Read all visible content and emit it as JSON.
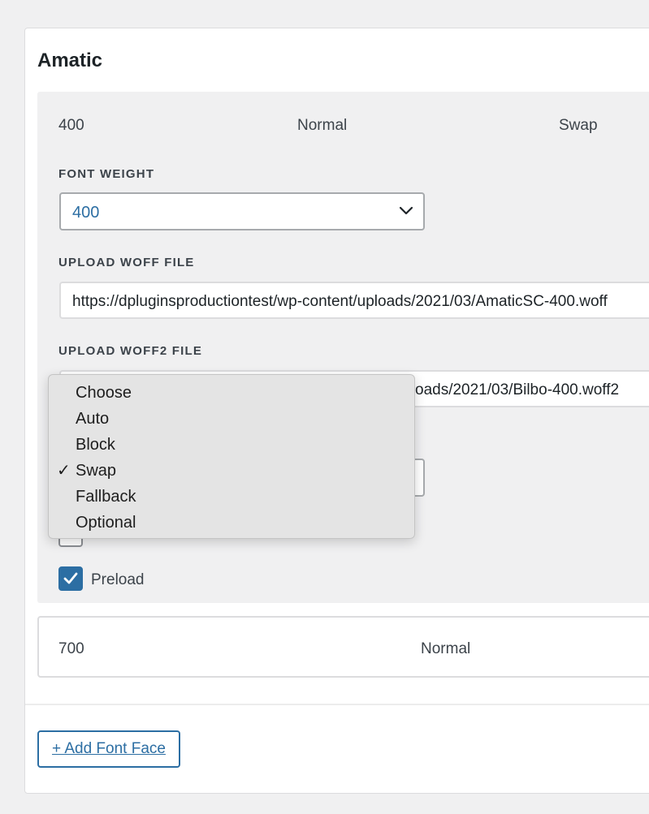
{
  "font_family": {
    "name": "Amatic"
  },
  "face_1": {
    "summary": {
      "weight": "400",
      "style": "Normal",
      "display": "Swap"
    },
    "font_weight": {
      "label": "FONT WEIGHT",
      "value": "400"
    },
    "woff": {
      "label": "UPLOAD WOFF FILE",
      "value": "https://dpluginsproductiontest/wp-content/uploads/2021/03/AmaticSC-400.woff"
    },
    "woff2": {
      "label": "UPLOAD WOFF2 FILE",
      "value_visible": "oads/2021/03/Bilbo-400.woff2"
    },
    "preload": {
      "label": "Preload",
      "checked": true
    }
  },
  "face_2": {
    "summary": {
      "weight": "700",
      "style": "Normal"
    }
  },
  "add_font_face": {
    "label": "+ Add Font Face"
  },
  "display_dropdown": {
    "options": [
      "Choose",
      "Auto",
      "Block",
      "Swap",
      "Fallback",
      "Optional"
    ],
    "selected": "Swap",
    "check_glyph": "✓"
  },
  "colors": {
    "accent": "#2c6ea3",
    "panel_bg": "#f0f0f1",
    "page_bg": "#f0f0f1"
  }
}
